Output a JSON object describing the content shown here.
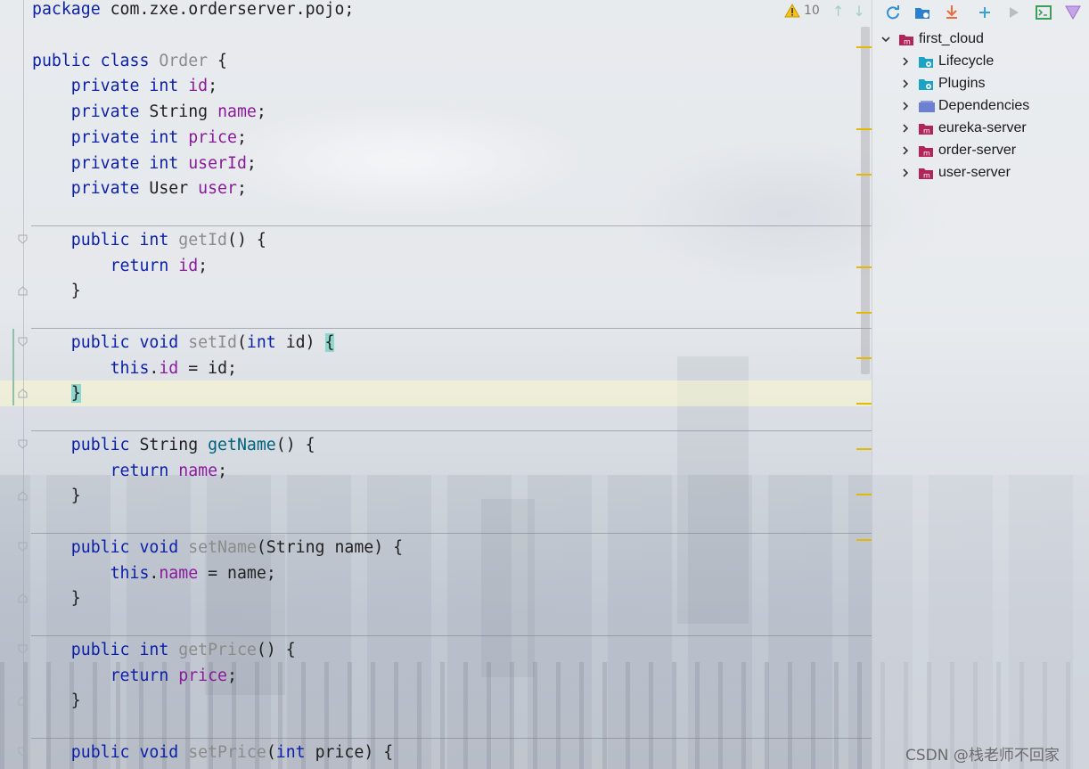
{
  "editor": {
    "lines": [
      [
        {
          "t": "package ",
          "c": "kw"
        },
        {
          "t": "com.zxe.orderserver.pojo;"
        }
      ],
      [],
      [
        {
          "t": "public class ",
          "c": "kw"
        },
        {
          "t": "Order",
          "c": "mthg"
        },
        {
          "t": " {"
        }
      ],
      [
        {
          "t": "    private int ",
          "c": "kw"
        },
        {
          "t": "id",
          "c": "fld"
        },
        {
          "t": ";"
        }
      ],
      [
        {
          "t": "    private ",
          "c": "kw"
        },
        {
          "t": "String "
        },
        {
          "t": "name",
          "c": "fld"
        },
        {
          "t": ";"
        }
      ],
      [
        {
          "t": "    private int ",
          "c": "kw"
        },
        {
          "t": "price",
          "c": "fld"
        },
        {
          "t": ";"
        }
      ],
      [
        {
          "t": "    private int ",
          "c": "kw"
        },
        {
          "t": "userId",
          "c": "fld"
        },
        {
          "t": ";"
        }
      ],
      [
        {
          "t": "    private ",
          "c": "kw"
        },
        {
          "t": "User "
        },
        {
          "t": "user",
          "c": "fld"
        },
        {
          "t": ";"
        }
      ],
      [],
      [
        {
          "t": "    public int ",
          "c": "kw"
        },
        {
          "t": "getId",
          "c": "mthg"
        },
        {
          "t": "() {"
        }
      ],
      [
        {
          "t": "        return ",
          "c": "kw"
        },
        {
          "t": "id",
          "c": "fld"
        },
        {
          "t": ";"
        }
      ],
      [
        {
          "t": "    }"
        }
      ],
      [],
      [
        {
          "t": "    public void ",
          "c": "kw"
        },
        {
          "t": "setId",
          "c": "mthg"
        },
        {
          "t": "("
        },
        {
          "t": "int ",
          "c": "kw"
        },
        {
          "t": "id) "
        },
        {
          "t": "{",
          "c": "brace-hl"
        }
      ],
      [
        {
          "t": "        this",
          "c": "kw"
        },
        {
          "t": "."
        },
        {
          "t": "id",
          "c": "fld"
        },
        {
          "t": " = id;"
        }
      ],
      [
        {
          "t": "    "
        },
        {
          "t": "}",
          "c": "brace-hl"
        }
      ],
      [],
      [
        {
          "t": "    public ",
          "c": "kw"
        },
        {
          "t": "String "
        },
        {
          "t": "getName",
          "c": "mth"
        },
        {
          "t": "() {"
        }
      ],
      [
        {
          "t": "        return ",
          "c": "kw"
        },
        {
          "t": "name",
          "c": "fld"
        },
        {
          "t": ";"
        }
      ],
      [
        {
          "t": "    }"
        }
      ],
      [],
      [
        {
          "t": "    public void ",
          "c": "kw"
        },
        {
          "t": "setName",
          "c": "mthg"
        },
        {
          "t": "(String name) {"
        }
      ],
      [
        {
          "t": "        this",
          "c": "kw"
        },
        {
          "t": "."
        },
        {
          "t": "name",
          "c": "fld"
        },
        {
          "t": " = name;"
        }
      ],
      [
        {
          "t": "    }"
        }
      ],
      [],
      [
        {
          "t": "    public int ",
          "c": "kw"
        },
        {
          "t": "getPrice",
          "c": "mthg"
        },
        {
          "t": "() {"
        }
      ],
      [
        {
          "t": "        return ",
          "c": "kw"
        },
        {
          "t": "price",
          "c": "fld"
        },
        {
          "t": ";"
        }
      ],
      [
        {
          "t": "    }"
        }
      ],
      [],
      [
        {
          "t": "    public void ",
          "c": "kw"
        },
        {
          "t": "setPrice",
          "c": "mthg"
        },
        {
          "t": "("
        },
        {
          "t": "int ",
          "c": "kw"
        },
        {
          "t": "price) {"
        }
      ]
    ],
    "warnings": {
      "count": "10",
      "icon": "warning-icon"
    }
  },
  "maven": {
    "toolbar": [
      "reload-icon",
      "folder-icon",
      "download-icon",
      "plus-icon",
      "run-icon",
      "terminal-icon",
      "maven-icon"
    ],
    "tree": [
      {
        "label": "first_cloud",
        "icon": "maven-module-icon",
        "expanded": true,
        "level": 0
      },
      {
        "label": "Lifecycle",
        "icon": "gear-folder-icon",
        "expanded": false,
        "level": 1
      },
      {
        "label": "Plugins",
        "icon": "gear-folder-icon",
        "expanded": false,
        "level": 1
      },
      {
        "label": "Dependencies",
        "icon": "dependencies-icon",
        "expanded": false,
        "level": 1
      },
      {
        "label": "eureka-server",
        "icon": "maven-module-icon",
        "expanded": false,
        "level": 1
      },
      {
        "label": "order-server",
        "icon": "maven-module-icon",
        "expanded": false,
        "level": 1
      },
      {
        "label": "user-server",
        "icon": "maven-module-icon",
        "expanded": false,
        "level": 1
      }
    ]
  },
  "watermark": "CSDN @栈老师不回家",
  "colors": {
    "keyword": "#0b1fa8",
    "field": "#8a1a9b",
    "method": "#00627a",
    "marker": "#e6b800"
  }
}
